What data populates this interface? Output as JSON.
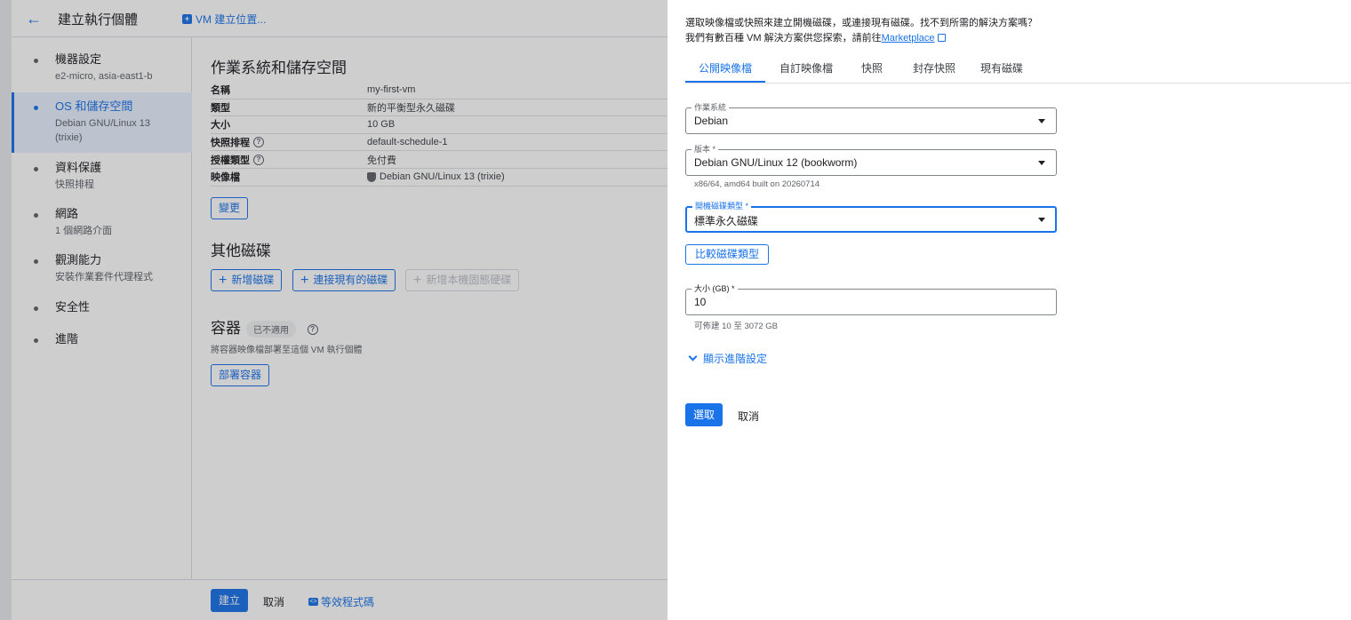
{
  "header": {
    "title": "建立執行個體",
    "vm_location_link": "VM 建立位置..."
  },
  "stepper": {
    "items": [
      {
        "title": "機器設定",
        "subtitle": "e2-micro, asia-east1-b"
      },
      {
        "title": "OS 和儲存空間",
        "subtitle": "Debian GNU/Linux 13 (trixie)"
      },
      {
        "title": "資料保護",
        "subtitle": "快照排程"
      },
      {
        "title": "網路",
        "subtitle": "1 個網路介面"
      },
      {
        "title": "觀測能力",
        "subtitle": "安裝作業套件代理程式"
      },
      {
        "title": "安全性",
        "subtitle": ""
      },
      {
        "title": "進階",
        "subtitle": ""
      }
    ]
  },
  "os_storage": {
    "title": "作業系統和儲存空間",
    "rows": [
      {
        "key": "名稱",
        "value": "my-first-vm"
      },
      {
        "key": "類型",
        "value": "新的平衡型永久磁碟"
      },
      {
        "key": "大小",
        "value": "10 GB"
      },
      {
        "key": "快照排程",
        "value": "default-schedule-1"
      },
      {
        "key": "授權類型",
        "value": "免付費"
      },
      {
        "key": "映像檔",
        "value": "Debian GNU/Linux 13 (trixie)"
      }
    ],
    "change_button": "變更"
  },
  "other_disks": {
    "title": "其他磁碟",
    "add_disk": "新增磁碟",
    "attach_existing": "連接現有的磁碟",
    "add_local_ssd": "新增本機固態硬碟"
  },
  "containers": {
    "title": "容器",
    "badge": "已不適用",
    "description": "將容器映像檔部署至這個 VM 執行個體",
    "deploy_button": "部署容器"
  },
  "footer": {
    "create": "建立",
    "cancel": "取消",
    "equivalent_code": "等效程式碼"
  },
  "panel": {
    "intro_line1": "選取映像檔或快照來建立開機磁碟，或連接現有磁碟。找不到所需的解決方案嗎？",
    "intro_line2": "我們有數百種 VM 解決方案供您探索，請前往",
    "marketplace_link": "Marketplace",
    "tabs": [
      "公開映像檔",
      "自訂映像檔",
      "快照",
      "封存快照",
      "現有磁碟"
    ],
    "os_label": "作業系統",
    "os_value": "Debian",
    "version_label": "版本 *",
    "version_value": "Debian GNU/Linux 12 (bookworm)",
    "version_hint": "x86/64, amd64 built on 20260714",
    "disk_type_label": "開機磁碟類型 *",
    "disk_type_value": "標準永久磁碟",
    "compare_button": "比較磁碟類型",
    "size_label": "大小 (GB) *",
    "size_value": "10",
    "size_hint": "可佈建 10 至 3072 GB",
    "advanced_toggle": "顯示進階設定",
    "select_button": "選取",
    "cancel_button": "取消"
  },
  "colors": {
    "accent": "#1a73e8",
    "active_step_bg": "#e8f0fe"
  },
  "icons": {
    "back": "arrow-left-icon",
    "help": "help-circle-icon",
    "image": "shield-icon",
    "add": "plus-icon",
    "code": "code-icon",
    "external": "external-link-icon",
    "dropdown": "caret-down-icon",
    "expand": "chevron-down-icon"
  }
}
